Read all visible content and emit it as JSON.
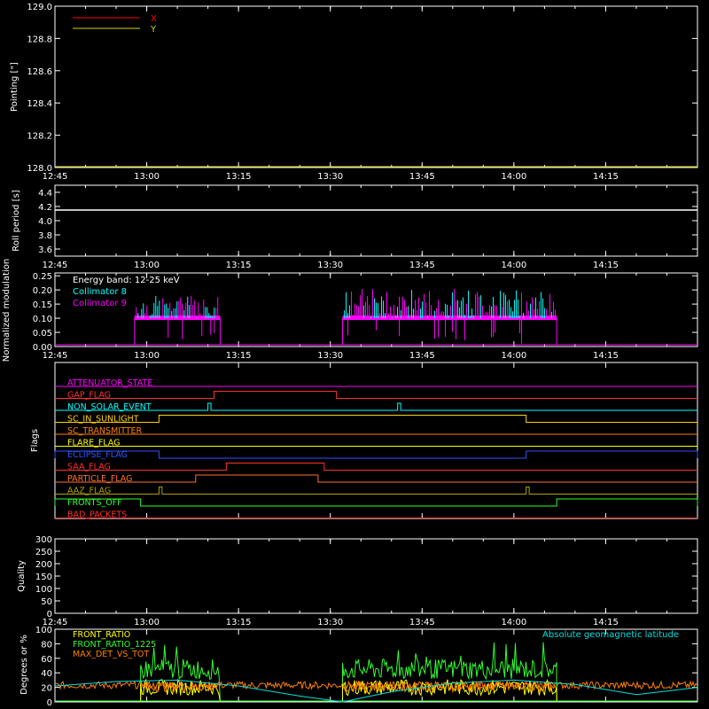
{
  "chart_data": [
    {
      "type": "line",
      "ylabel": "Pointing [\"]",
      "ylim": [
        128.0,
        129.0
      ],
      "yticks": [
        "128.0",
        "128.2",
        "128.4",
        "128.6",
        "128.8",
        "129.0"
      ],
      "xticks": [
        "12:45",
        "13:00",
        "13:15",
        "13:30",
        "13:45",
        "14:00",
        "14:15"
      ],
      "legend_placement": "top-left",
      "series": [
        {
          "name": "X",
          "color": "#ff0000",
          "values": []
        },
        {
          "name": "Y",
          "color": "#d4d400",
          "values": []
        }
      ]
    },
    {
      "type": "line",
      "ylabel": "Roll period [s]",
      "ylim": [
        3.5,
        4.5
      ],
      "yticks": [
        "3.6",
        "3.8",
        "4.0",
        "4.2",
        "4.4"
      ],
      "xticks": [
        "12:45",
        "13:00",
        "13:15",
        "13:30",
        "13:45",
        "14:00",
        "14:15"
      ],
      "series": [
        {
          "color": "#ffffff",
          "x": [
            "12:45",
            "14:30"
          ],
          "values": [
            4.15,
            4.15
          ]
        }
      ]
    },
    {
      "type": "line",
      "ylabel": "Normalized modulation",
      "ylim": [
        0.0,
        0.26
      ],
      "yticks": [
        "0.00",
        "0.05",
        "0.10",
        "0.15",
        "0.20",
        "0.25"
      ],
      "xticks": [
        "12:45",
        "13:00",
        "13:15",
        "13:30",
        "13:45",
        "14:00",
        "14:15"
      ],
      "annotation": "Energy band: 12-25 keV",
      "legend_placement": "top-left",
      "active_intervals": [
        [
          "12:58",
          "13:12"
        ],
        [
          "13:32",
          "14:07"
        ]
      ],
      "typical_value": 0.1,
      "series": [
        {
          "name": "Collimator 8",
          "color": "#00ffff"
        },
        {
          "name": "Collimator 9",
          "color": "#ff00ff"
        }
      ]
    },
    {
      "type": "line",
      "ylabel": "Flags",
      "xticks": [
        "12:45",
        "13:00",
        "13:15",
        "13:30",
        "13:45",
        "14:00",
        "14:15"
      ],
      "flags": [
        {
          "name": "ATTENUATOR_STATE",
          "color": "#ff00ff",
          "on": []
        },
        {
          "name": "GAP_FLAG",
          "color": "#ff3030",
          "on": [
            [
              "13:11",
              "13:31"
            ]
          ]
        },
        {
          "name": "NON_SOLAR_EVENT",
          "color": "#00ffff",
          "on": [
            [
              "13:10",
              "13:10.5"
            ],
            [
              "13:41",
              "13:41.5"
            ]
          ]
        },
        {
          "name": "SC_IN_SUNLIGHT",
          "color": "#ffd000",
          "on": [
            [
              "13:02",
              "14:02"
            ]
          ]
        },
        {
          "name": "SC_TRANSMITTER",
          "color": "#ff8000",
          "on": []
        },
        {
          "name": "FLARE_FLAG",
          "color": "#ffff00",
          "on": []
        },
        {
          "name": "ECLIPSE_FLAG",
          "color": "#3050ff",
          "on": [
            [
              "12:45",
              "13:02"
            ],
            [
              "14:02",
              "14:30"
            ]
          ]
        },
        {
          "name": "SAA_FLAG",
          "color": "#ff3030",
          "on": [
            [
              "13:13",
              "13:29"
            ]
          ]
        },
        {
          "name": "PARTICLE_FLAG",
          "color": "#ff7030",
          "on": [
            [
              "13:08",
              "13:28"
            ]
          ]
        },
        {
          "name": "AAZ_FLAG",
          "color": "#b0a000",
          "on": [
            [
              "13:02",
              "13:02.5"
            ],
            [
              "14:02",
              "14:02.5"
            ]
          ]
        },
        {
          "name": "FRONTS_OFF",
          "color": "#30ff30",
          "on": [
            [
              "12:45",
              "12:59"
            ],
            [
              "14:07",
              "14:30"
            ]
          ]
        },
        {
          "name": "BAD_PACKETS",
          "color": "#ff3030",
          "on": []
        }
      ]
    },
    {
      "type": "line",
      "ylabel": "Quality",
      "ylim": [
        0,
        300
      ],
      "yticks": [
        "0",
        "50",
        "100",
        "150",
        "200",
        "250",
        "300"
      ],
      "xticks": [
        "12:45",
        "13:00",
        "13:15",
        "13:30",
        "13:45",
        "14:00",
        "14:15"
      ],
      "series": []
    },
    {
      "type": "line",
      "ylabel": "Degrees or %",
      "ylim": [
        0,
        100
      ],
      "yticks": [
        "0",
        "20",
        "40",
        "60",
        "80",
        "100"
      ],
      "legend_placement": "top-left",
      "annotation": "Absolute geomagnetic latitude",
      "active_intervals": [
        [
          "12:59",
          "13:12"
        ],
        [
          "13:32",
          "14:07"
        ]
      ],
      "series": [
        {
          "name": "FRONT_RATIO",
          "color": "#ffff00",
          "typical_value": 20
        },
        {
          "name": "FRONT_RATIO_1225",
          "color": "#30ff30",
          "typical_value": 45
        },
        {
          "name": "MAX_DET_VS_TOT",
          "color": "#ff8000",
          "typical_value": 18
        },
        {
          "name": "Absolute geomagnetic latitude",
          "color": "#00e0e0",
          "x": [
            "12:45",
            "12:55",
            "13:05",
            "13:15",
            "13:25",
            "13:32",
            "13:40",
            "13:50",
            "14:00",
            "14:10",
            "14:20",
            "14:30"
          ],
          "values": [
            22,
            28,
            30,
            22,
            8,
            0,
            14,
            26,
            30,
            24,
            10,
            20
          ]
        }
      ]
    }
  ],
  "colors": {
    "background": "#000000",
    "axis": "#ffffff"
  }
}
